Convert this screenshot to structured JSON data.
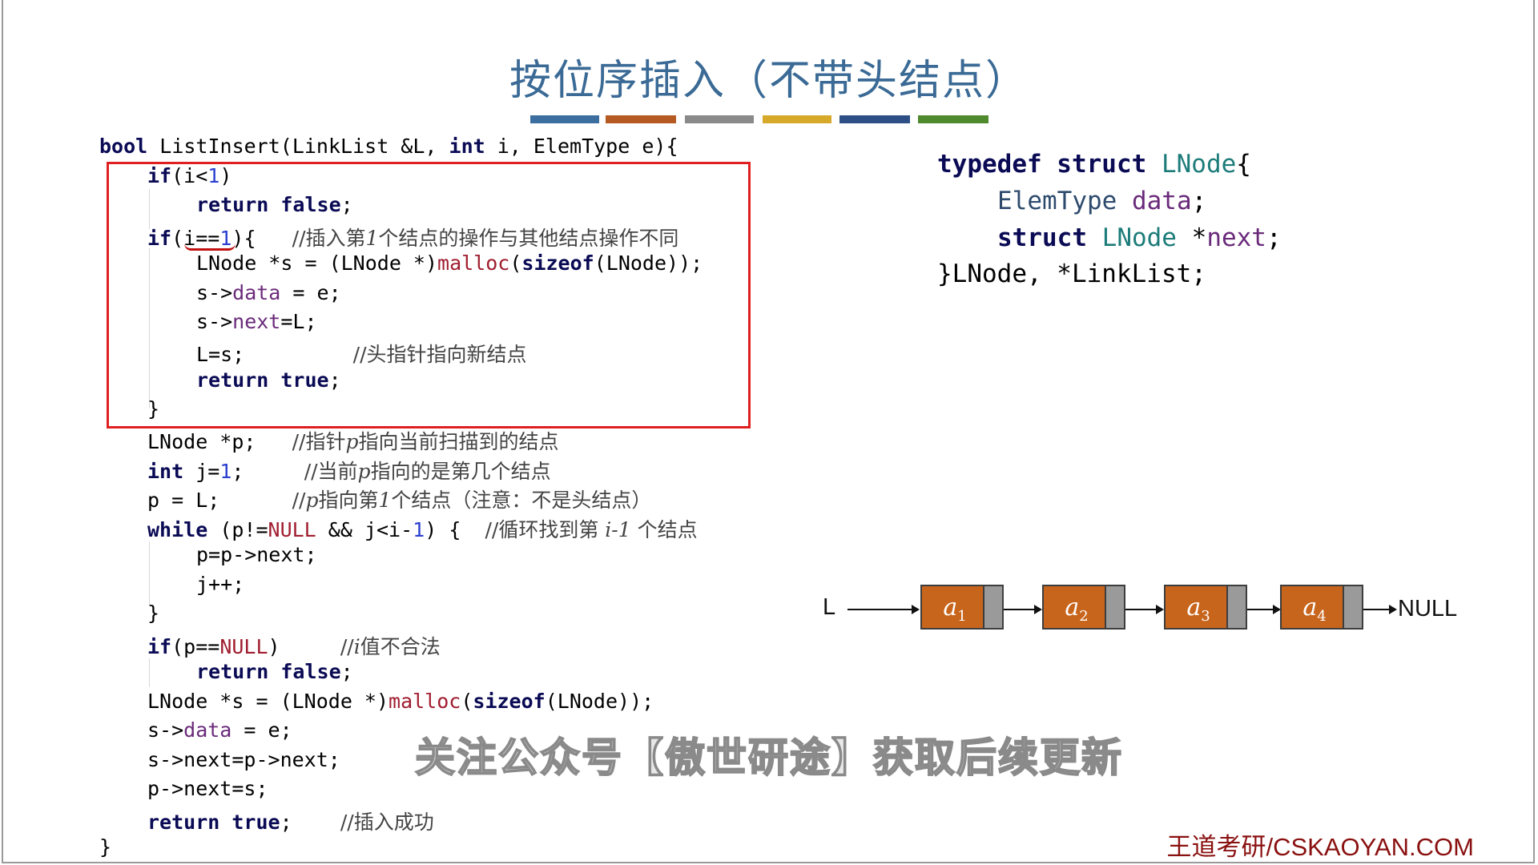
{
  "title": "按位序插入（不带头结点）",
  "color_bar": [
    "#3c6ea0",
    "#b65a23",
    "#8a8a8a",
    "#d6a92a",
    "#2e4f86",
    "#4f8a2e"
  ],
  "code": {
    "l01": {
      "a": "bool",
      "b": " ListInsert(LinkList &L, ",
      "c": "int",
      "d": " i, ElemType e){"
    },
    "l02": {
      "a": "if",
      "b": "(i<",
      "c": "1",
      "d": ")"
    },
    "l03": {
      "a": "return false",
      "b": ";"
    },
    "l04": {
      "a": "if",
      "b": "(i==",
      "c": "1",
      "d": "){   ",
      "e": "//插入第",
      "f": "1",
      "g": "个结点的操作与其他结点操作不同"
    },
    "l05": {
      "a": "LNode *s = (LNode *)",
      "b": "malloc",
      "c": "(",
      "d": "sizeof",
      "e": "(LNode));"
    },
    "l06": {
      "a": "s->",
      "b": "data",
      "c": " = e;"
    },
    "l07": {
      "a": "s->",
      "b": "next",
      "c": "=L;"
    },
    "l08": {
      "a": "L=s;         ",
      "b": "//头指针指向新结点"
    },
    "l09": {
      "a": "return true",
      "b": ";"
    },
    "l10": {
      "a": "}"
    },
    "l11": {
      "a": "LNode *p;   ",
      "b": "//指针",
      "c": "p",
      "d": "指向当前扫描到的结点"
    },
    "l12": {
      "a": "int",
      "b": " j=",
      "c": "1",
      "d": ";     ",
      "e": "//当前",
      "f": "p",
      "g": "指向的是第几个结点"
    },
    "l13": {
      "a": "p = L;      ",
      "b": "//",
      "c": "p",
      "d": "指向第",
      "e": "1",
      "f": "个结点（注意：不是头结点）"
    },
    "l14": {
      "a": "while",
      "b": " (p!=",
      "c": "NULL",
      "d": " && j<i-",
      "e": "1",
      "f": ") {  ",
      "g": "//循环找到第 ",
      "h": "i-1",
      "i": " 个结点"
    },
    "l15": {
      "a": "p=p->next;"
    },
    "l16": {
      "a": "j++;"
    },
    "l17": {
      "a": "}"
    },
    "l18": {
      "a": "if",
      "b": "(p==",
      "c": "NULL",
      "d": ")     ",
      "e": "//",
      "f": "i",
      "g": "值不合法"
    },
    "l19": {
      "a": "return false",
      "b": ";"
    },
    "l20": {
      "a": "LNode *s = (LNode *)",
      "b": "malloc",
      "c": "(",
      "d": "sizeof",
      "e": "(LNode));"
    },
    "l21": {
      "a": "s->",
      "b": "data",
      "c": " = e;"
    },
    "l22": {
      "a": "s->next=p->next;"
    },
    "l23": {
      "a": "p->next=s;"
    },
    "l24": {
      "a": "return true",
      "b": ";    ",
      "c": "//插入成功"
    },
    "l25": {
      "a": "}"
    }
  },
  "typedef": {
    "t1": {
      "a": "typedef struct ",
      "b": "LNode",
      "c": "{"
    },
    "t2": {
      "a": "ElemType ",
      "b": "data",
      "c": ";"
    },
    "t3": {
      "a": "struct ",
      "b": "LNode ",
      "c": "*",
      "d": "next",
      "e": ";"
    },
    "t4": {
      "a": "}LNode, *LinkList;"
    }
  },
  "list": {
    "head_label": "L",
    "nodes": [
      {
        "name": "a",
        "sub": "1"
      },
      {
        "name": "a",
        "sub": "2"
      },
      {
        "name": "a",
        "sub": "3"
      },
      {
        "name": "a",
        "sub": "4"
      }
    ],
    "tail_label": "NULL"
  },
  "watermark": "关注公众号【傲世研途】获取后续更新",
  "brand": "王道考研/CSKAOYAN.COM"
}
